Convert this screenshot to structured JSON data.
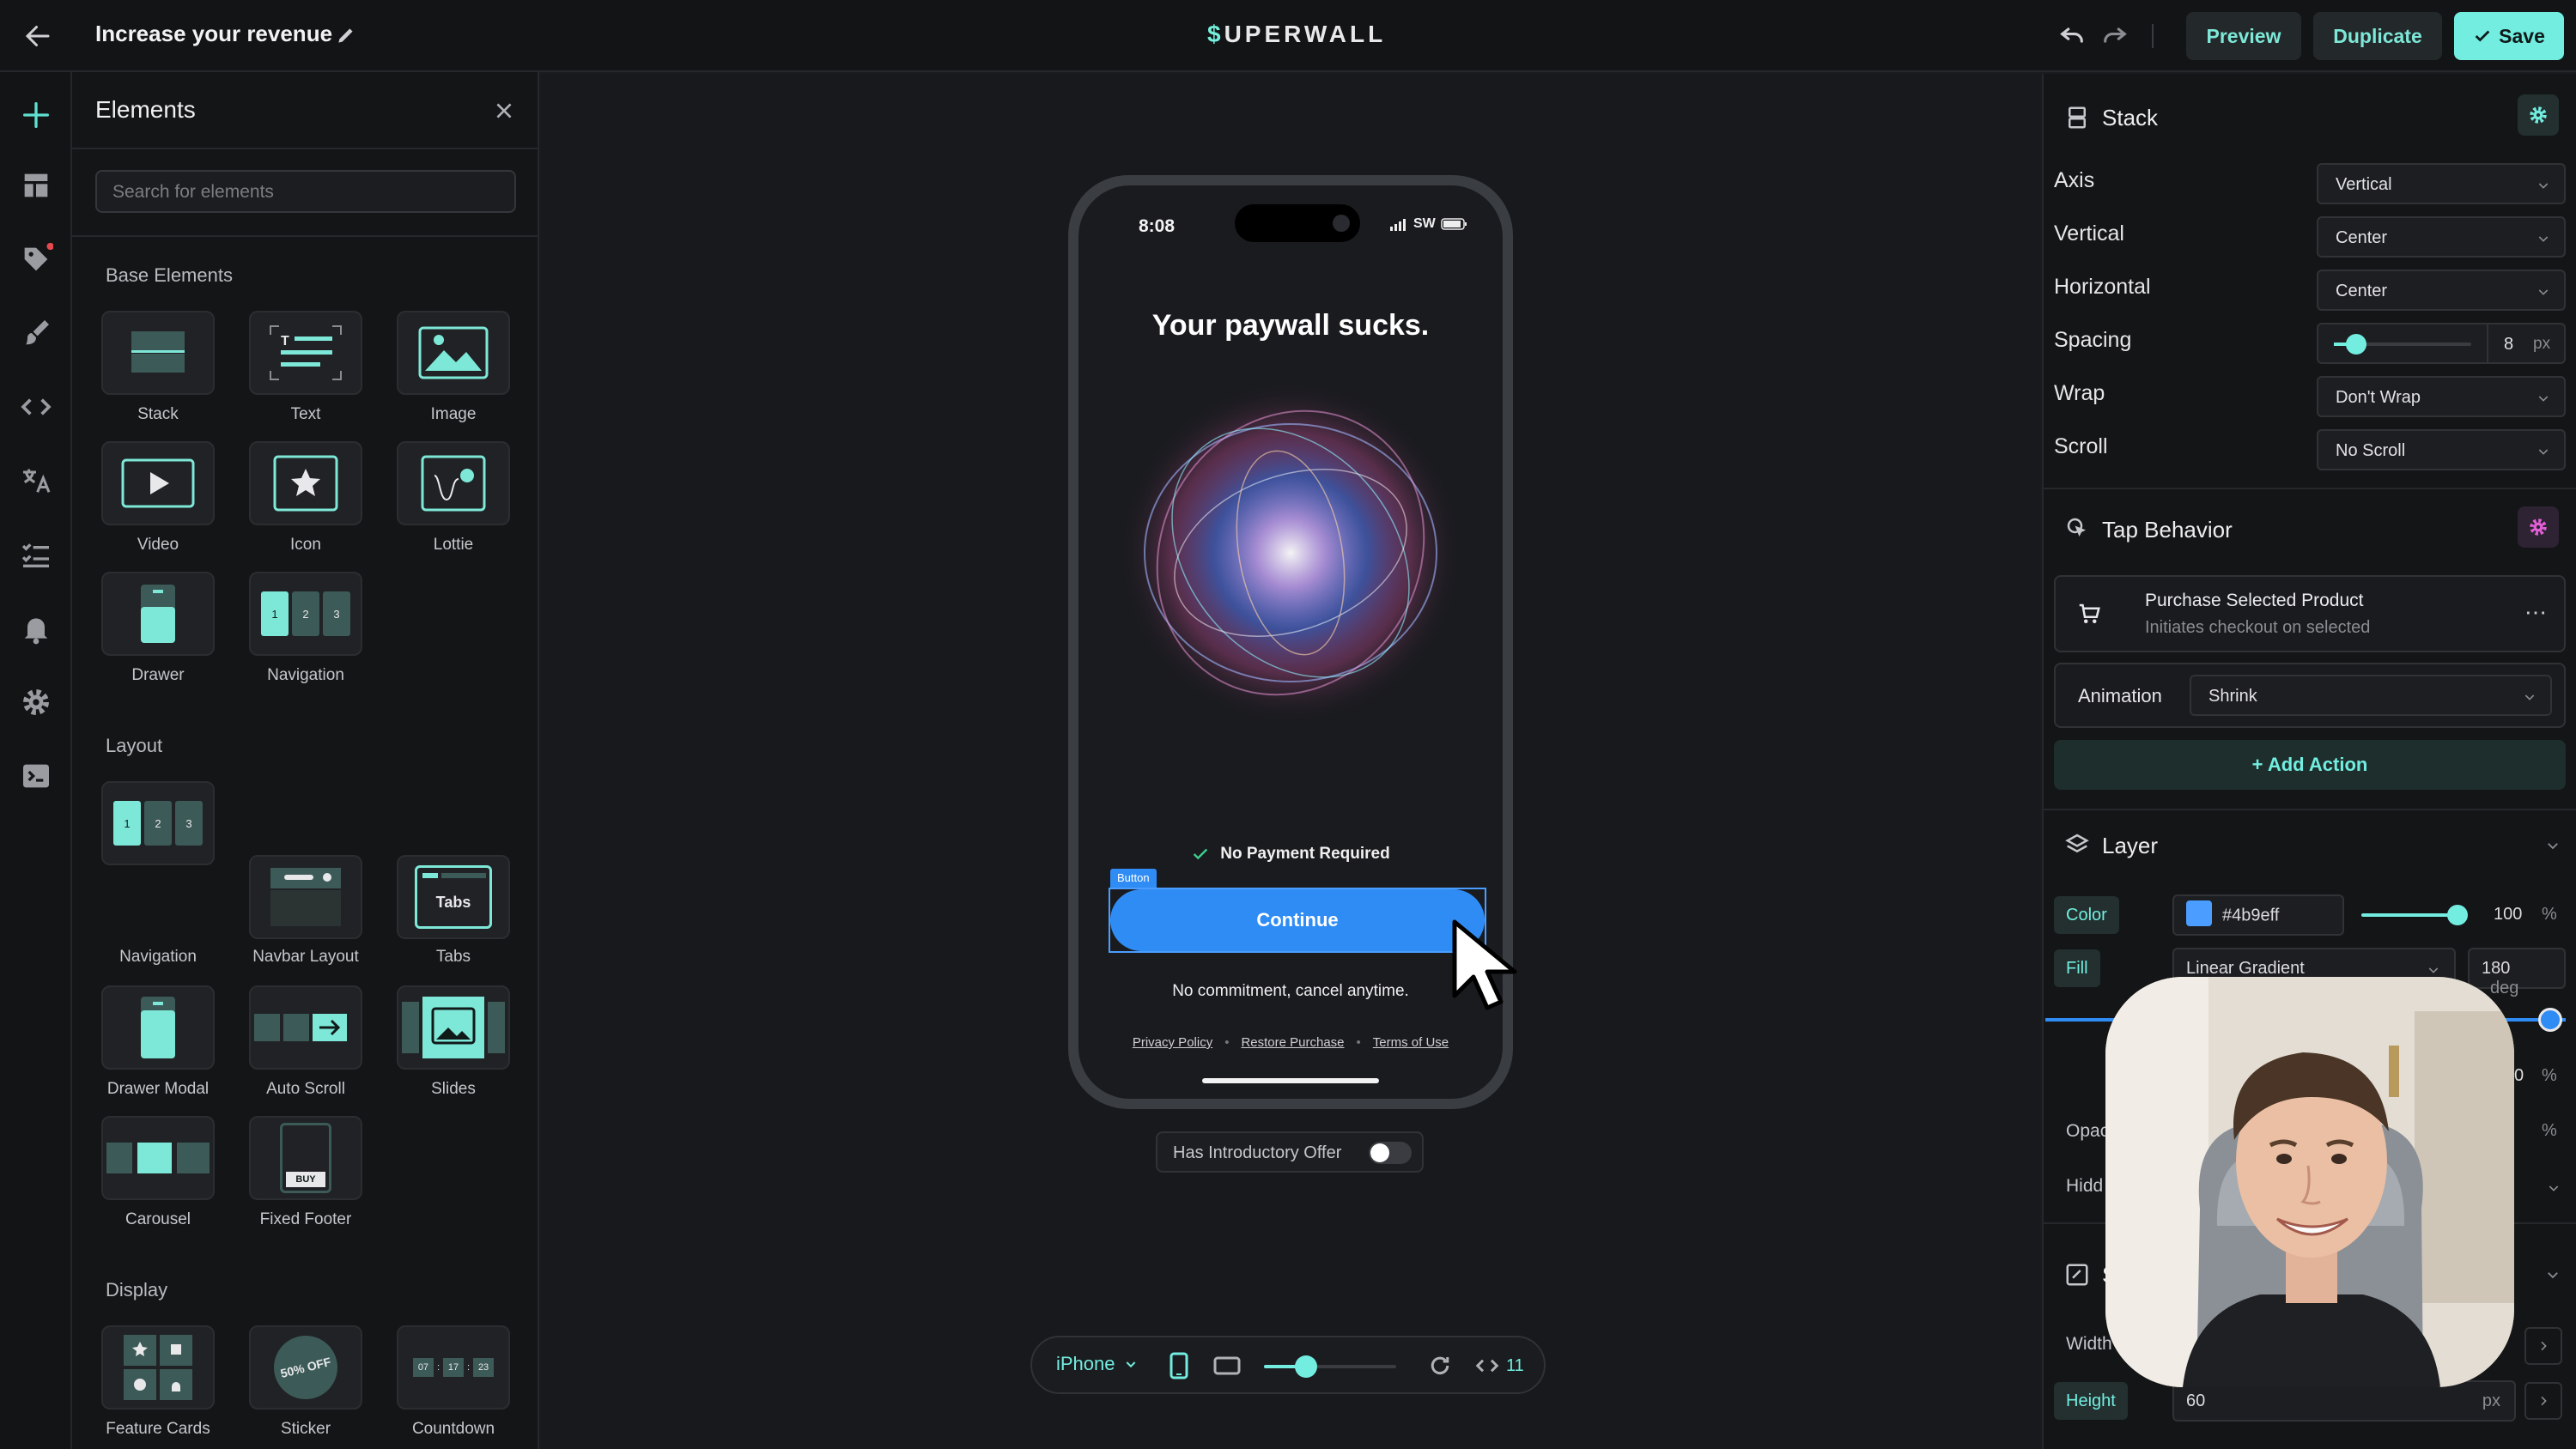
{
  "topbar": {
    "title": "Increase your revenue",
    "logo_symbol": "$",
    "logo_text": "UPERWALL",
    "preview_label": "Preview",
    "duplicate_label": "Duplicate",
    "save_label": "Save"
  },
  "elements_panel": {
    "title": "Elements",
    "search_placeholder": "Search for elements",
    "sections": {
      "base": {
        "label": "Base Elements",
        "items": [
          "Stack",
          "Text",
          "Image",
          "Video",
          "Icon",
          "Lottie",
          "Drawer",
          "Navigation"
        ]
      },
      "layout": {
        "label": "Layout",
        "items": [
          "Navigation",
          "Navbar Layout",
          "Tabs",
          "Drawer Modal",
          "Auto Scroll",
          "Slides",
          "Carousel",
          "Fixed Footer"
        ]
      },
      "display": {
        "label": "Display",
        "items": [
          "Feature Cards",
          "Sticker",
          "Countdown"
        ]
      }
    },
    "tile_texts": {
      "tabs": "Tabs",
      "buy": "BUY",
      "sticker": "50% OFF",
      "nav_numbers": [
        "1",
        "2",
        "3"
      ],
      "countdown": [
        "07",
        "17",
        "23"
      ]
    }
  },
  "phone": {
    "time": "8:08",
    "carrier": "SW",
    "headline": "Your paywall sucks.",
    "no_payment": "No Payment Required",
    "selection_tag": "Button",
    "cta_label": "Continue",
    "subtext": "No commitment, cancel anytime.",
    "links": [
      "Privacy Policy",
      "Restore Purchase",
      "Terms of Use"
    ],
    "toggle_label": "Has Introductory Offer"
  },
  "canvas_toolbar": {
    "device": "iPhone",
    "code_count": "11"
  },
  "right_panel": {
    "stack": {
      "title": "Stack",
      "rows": [
        {
          "label": "Axis",
          "value": "Vertical"
        },
        {
          "label": "Vertical",
          "value": "Center"
        },
        {
          "label": "Horizontal",
          "value": "Center"
        },
        {
          "label": "Spacing",
          "value": "8",
          "unit": "px"
        },
        {
          "label": "Wrap",
          "value": "Don't Wrap"
        },
        {
          "label": "Scroll",
          "value": "No Scroll"
        }
      ]
    },
    "tap": {
      "title": "Tap Behavior",
      "action_title": "Purchase Selected Product",
      "action_desc": "Initiates checkout on selected",
      "animation_label": "Animation",
      "animation_value": "Shrink",
      "add_action": "+ Add Action"
    },
    "layer": {
      "title": "Layer",
      "color_label": "Color",
      "color_value": "#4b9eff",
      "color_opacity": "100",
      "percent": "%",
      "fill_label": "Fill",
      "fill_value": "Linear Gradient",
      "fill_angle": "180",
      "fill_unit": "deg",
      "partial_pct": "0",
      "opacity_partial": "Opac",
      "hidden_partial": "Hidd",
      "size_partial": "S",
      "width_label": "Width",
      "height_label": "Height",
      "height_value": "60",
      "height_unit": "px"
    }
  },
  "colors": {
    "accent": "#72ede0",
    "cta_blue": "#2f8cf5",
    "selection": "#4b9eff"
  }
}
